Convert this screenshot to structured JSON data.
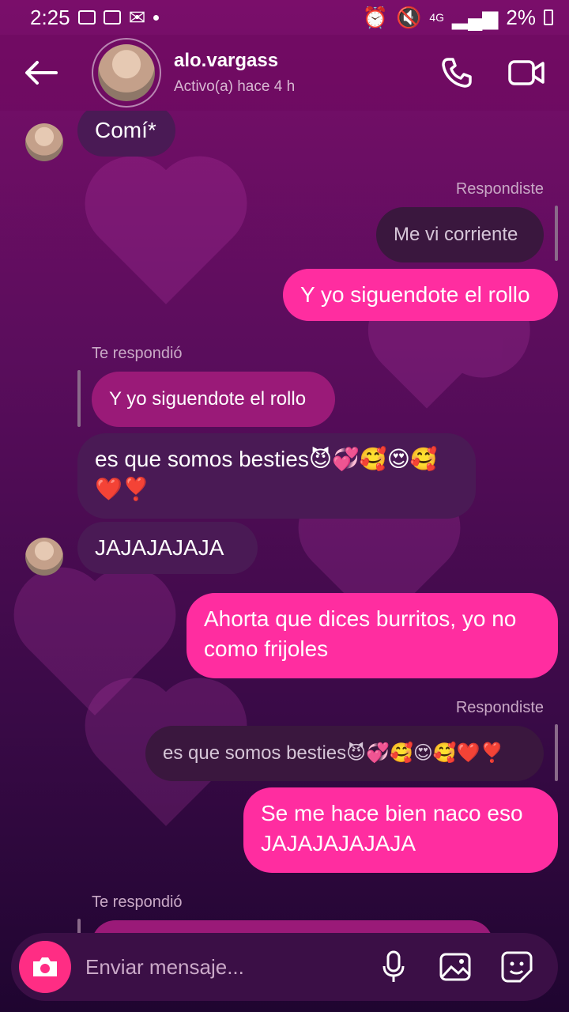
{
  "status": {
    "time": "2:25",
    "battery": "2%",
    "network": "4G"
  },
  "header": {
    "username": "alo.vargass",
    "active": "Activo(a) hace 4 h"
  },
  "messages": {
    "m1": "Comí*",
    "label1": "Respondiste",
    "quote1": "Me vi corriente",
    "m2": "Y yo siguendote el rollo",
    "label2": "Te respondió",
    "reply2": "Y yo siguendote el rollo",
    "m3_line1": "es que somos besties😈💞🥰😍🥰",
    "m3_line2": "❤️❣️",
    "m4": "JAJAJAJAJA",
    "m5": "Ahorta que dices burritos, yo no como frijoles",
    "label3": "Respondiste",
    "quote3": "es que somos besties😈💞🥰😍🥰❤️❣️",
    "m6": "Se me hace bien naco eso JAJAJAJAJAJA",
    "label4": "Te respondió"
  },
  "composer": {
    "placeholder": "Enviar mensaje..."
  },
  "colors": {
    "outgoing": "#ff2da0",
    "incoming": "#4a1a55",
    "accent": "#ff2d84"
  }
}
